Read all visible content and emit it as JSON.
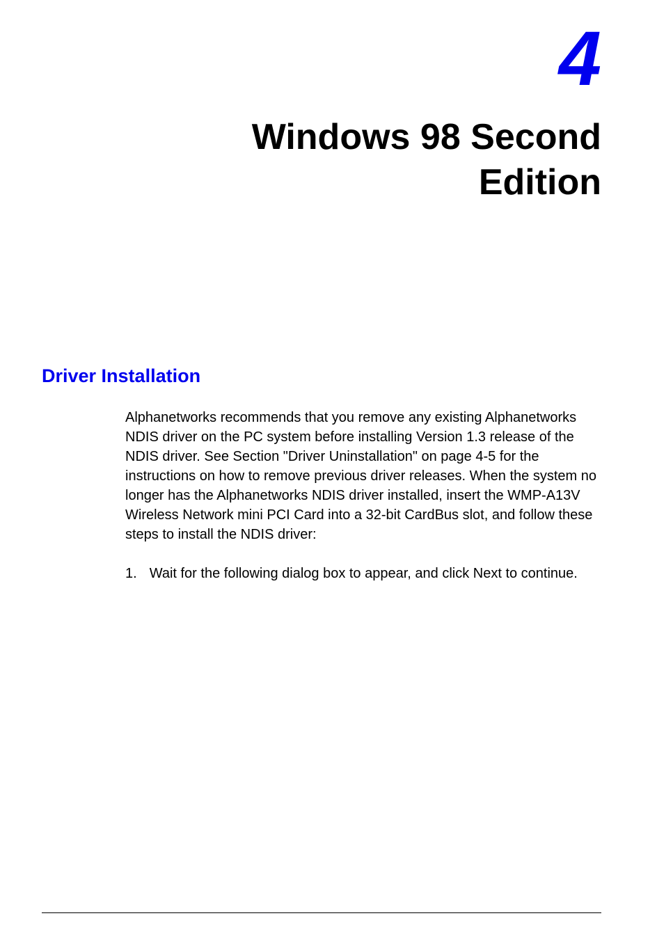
{
  "chapter": {
    "number": "4",
    "title_line1": "Windows 98 Second",
    "title_line2": "Edition"
  },
  "section": {
    "heading": "Driver Installation",
    "paragraph": "Alphanetworks recommends that you remove any existing Alphanetworks NDIS driver on the PC system before installing Version 1.3 release of the NDIS driver. See Section \"Driver Uninstallation\" on page 4-5 for the instructions on how to remove previous driver releases. When the system no longer has the Alphanetworks NDIS driver installed, insert the WMP-A13V Wireless Network mini PCI Card into a 32-bit CardBus slot, and follow these steps to install the NDIS driver:"
  },
  "list": {
    "item1": {
      "number": "1.",
      "text": "Wait for the following dialog box to appear, and click Next to continue."
    }
  }
}
